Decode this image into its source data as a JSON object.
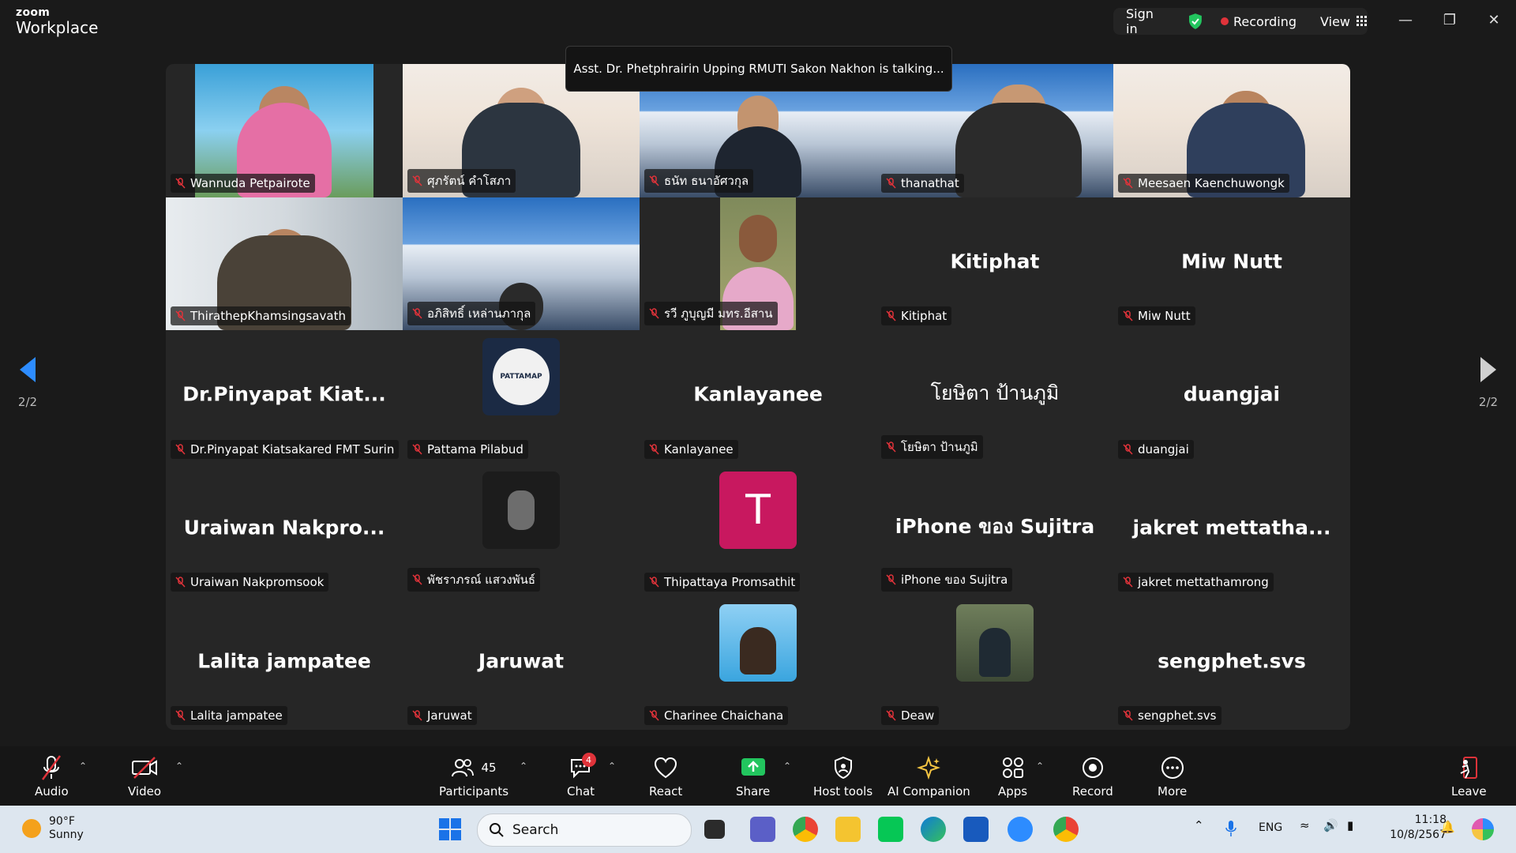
{
  "app": {
    "brand_small": "zoom",
    "brand_big": "Workplace",
    "sign_in": "Sign in",
    "recording": "Recording",
    "view": "View"
  },
  "talking_banner": "Asst. Dr. Phetphrairin Upping RMUTI Sakon Nakhon is talking...",
  "page_indicator": "2/2",
  "tiles": [
    {
      "name": "Wannuda Petpairote"
    },
    {
      "name": "ศุภรัตน์   คำโสภา"
    },
    {
      "name": "ธนัท ธนาอัศวกุล"
    },
    {
      "name": "thanathat"
    },
    {
      "name": "Meesaen Kaenchuwongk"
    },
    {
      "name": "ThirathepKhamsingsavath"
    },
    {
      "name": "อภิสิทธิ์ เหล่านภากุล"
    },
    {
      "name": "รวี ภูบุญมี มทร.อีสาน"
    },
    {
      "name": "Kitiphat",
      "display": "Kitiphat"
    },
    {
      "name": "Miw Nutt",
      "display": "Miw Nutt"
    },
    {
      "name": "Dr.Pinyapat Kiatsakared FMT Surin",
      "display": "Dr.Pinyapat  Kiat..."
    },
    {
      "name": "Pattama Pilabud",
      "avatar_text": "PATTAMAP"
    },
    {
      "name": "Kanlayanee",
      "display": "Kanlayanee"
    },
    {
      "name": "โยษิตา ป้านภูมิ",
      "display": "โยษิตา ป้านภูมิ"
    },
    {
      "name": "duangjai",
      "display": "duangjai"
    },
    {
      "name": "Uraiwan Nakpromsook",
      "display": "Uraiwan  Nakpro..."
    },
    {
      "name": "พัชราภรณ์ แสวงพันธ์"
    },
    {
      "name": "Thipattaya Promsathit",
      "avatar_text": "T"
    },
    {
      "name": "iPhone ของ Sujitra",
      "display": "iPhone ของ Sujitra"
    },
    {
      "name": "jakret mettathamrong",
      "display": "jakret  mettatha..."
    },
    {
      "name": "Lalita jampatee",
      "display": "Lalita jampatee"
    },
    {
      "name": "Jaruwat",
      "display": "Jaruwat"
    },
    {
      "name": "Charinee  Chaichana"
    },
    {
      "name": "Deaw"
    },
    {
      "name": "sengphet.svs",
      "display": "sengphet.svs"
    }
  ],
  "toolbar": {
    "audio": "Audio",
    "video": "Video",
    "participants": "Participants",
    "participants_count": "45",
    "chat": "Chat",
    "chat_badge": "4",
    "react": "React",
    "share": "Share",
    "host_tools": "Host tools",
    "ai_companion": "AI Companion",
    "apps": "Apps",
    "record": "Record",
    "more": "More",
    "leave": "Leave"
  },
  "taskbar": {
    "temp": "90°F",
    "condition": "Sunny",
    "search_placeholder": "Search",
    "lang": "ENG",
    "time": "11:18",
    "date": "10/8/2567"
  },
  "colors": {
    "bg": "#1a1a1a",
    "grid": "#262626",
    "accent_blue": "#2d8cff",
    "rec_red": "#e0333a",
    "share_green": "#22c55e",
    "avatar_pink": "#c8185f"
  }
}
